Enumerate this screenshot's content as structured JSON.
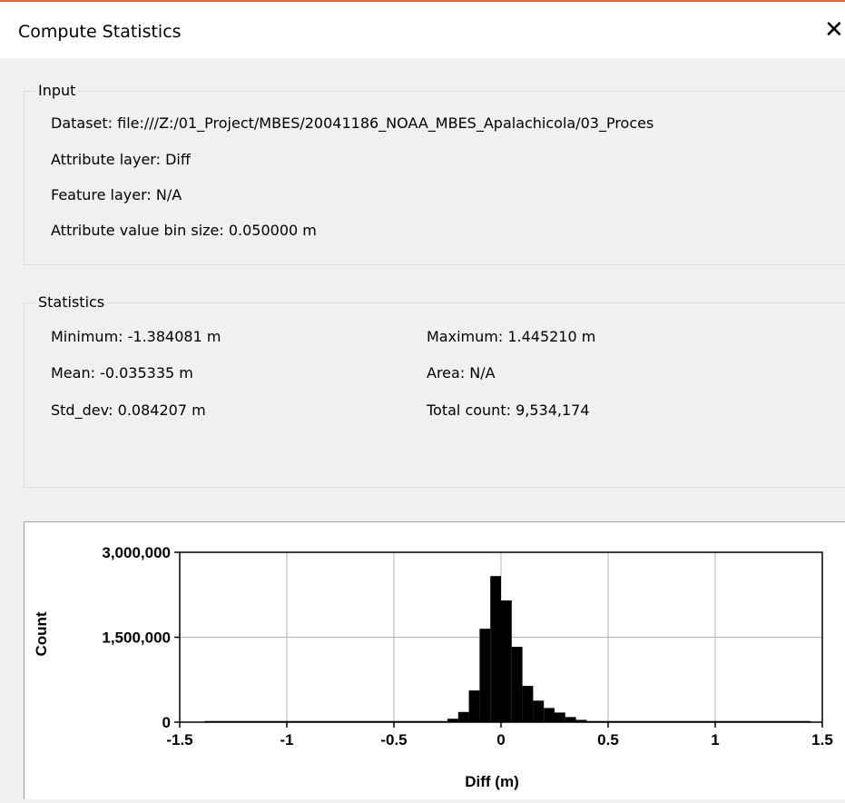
{
  "window": {
    "title": "Compute Statistics",
    "close_glyph": "✕"
  },
  "input_group": {
    "legend": "Input",
    "dataset": "Dataset: file:///Z:/01_Project/MBES/20041186_NOAA_MBES_Apalachicola/03_Proces",
    "attribute_layer": "Attribute layer: Diff",
    "feature_layer": "Feature layer: N/A",
    "bin_size": "Attribute value bin size: 0.050000 m"
  },
  "statistics_group": {
    "legend": "Statistics",
    "minimum": "Minimum: -1.384081 m",
    "maximum": "Maximum: 1.445210 m",
    "mean": "Mean: -0.035335 m",
    "area": "Area: N/A",
    "std_dev": "Std_dev: 0.084207 m",
    "total_count": "Total count: 9,534,174"
  },
  "colors": {
    "accent_line": "#e8643c",
    "bars": "#000000",
    "grid": "#b4b4b4"
  },
  "chart_data": {
    "type": "bar",
    "xlabel": "Diff (m)",
    "ylabel": "Count",
    "xlim": [
      -1.5,
      1.5
    ],
    "ylim": [
      0,
      3000000
    ],
    "x_ticks": [
      -1.5,
      -1,
      -0.5,
      0,
      0.5,
      1,
      1.5
    ],
    "x_tick_labels": [
      "-1.5",
      "-1",
      "-0.5",
      "0",
      "0.5",
      "1",
      "1.5"
    ],
    "y_ticks": [
      0,
      1500000,
      3000000
    ],
    "y_tick_labels": [
      "0",
      "1,500,000",
      "3,000,000"
    ],
    "bin_width": 0.05,
    "bins": [
      {
        "x0": -0.3,
        "value": 10000
      },
      {
        "x0": -0.25,
        "value": 60000
      },
      {
        "x0": -0.2,
        "value": 180000
      },
      {
        "x0": -0.15,
        "value": 560000
      },
      {
        "x0": -0.1,
        "value": 1650000
      },
      {
        "x0": -0.05,
        "value": 2580000
      },
      {
        "x0": 0.0,
        "value": 2150000
      },
      {
        "x0": 0.05,
        "value": 1330000
      },
      {
        "x0": 0.1,
        "value": 640000
      },
      {
        "x0": 0.15,
        "value": 380000
      },
      {
        "x0": 0.2,
        "value": 250000
      },
      {
        "x0": 0.25,
        "value": 170000
      },
      {
        "x0": 0.3,
        "value": 90000
      },
      {
        "x0": 0.35,
        "value": 40000
      },
      {
        "x0": 0.4,
        "value": 15000
      }
    ]
  }
}
